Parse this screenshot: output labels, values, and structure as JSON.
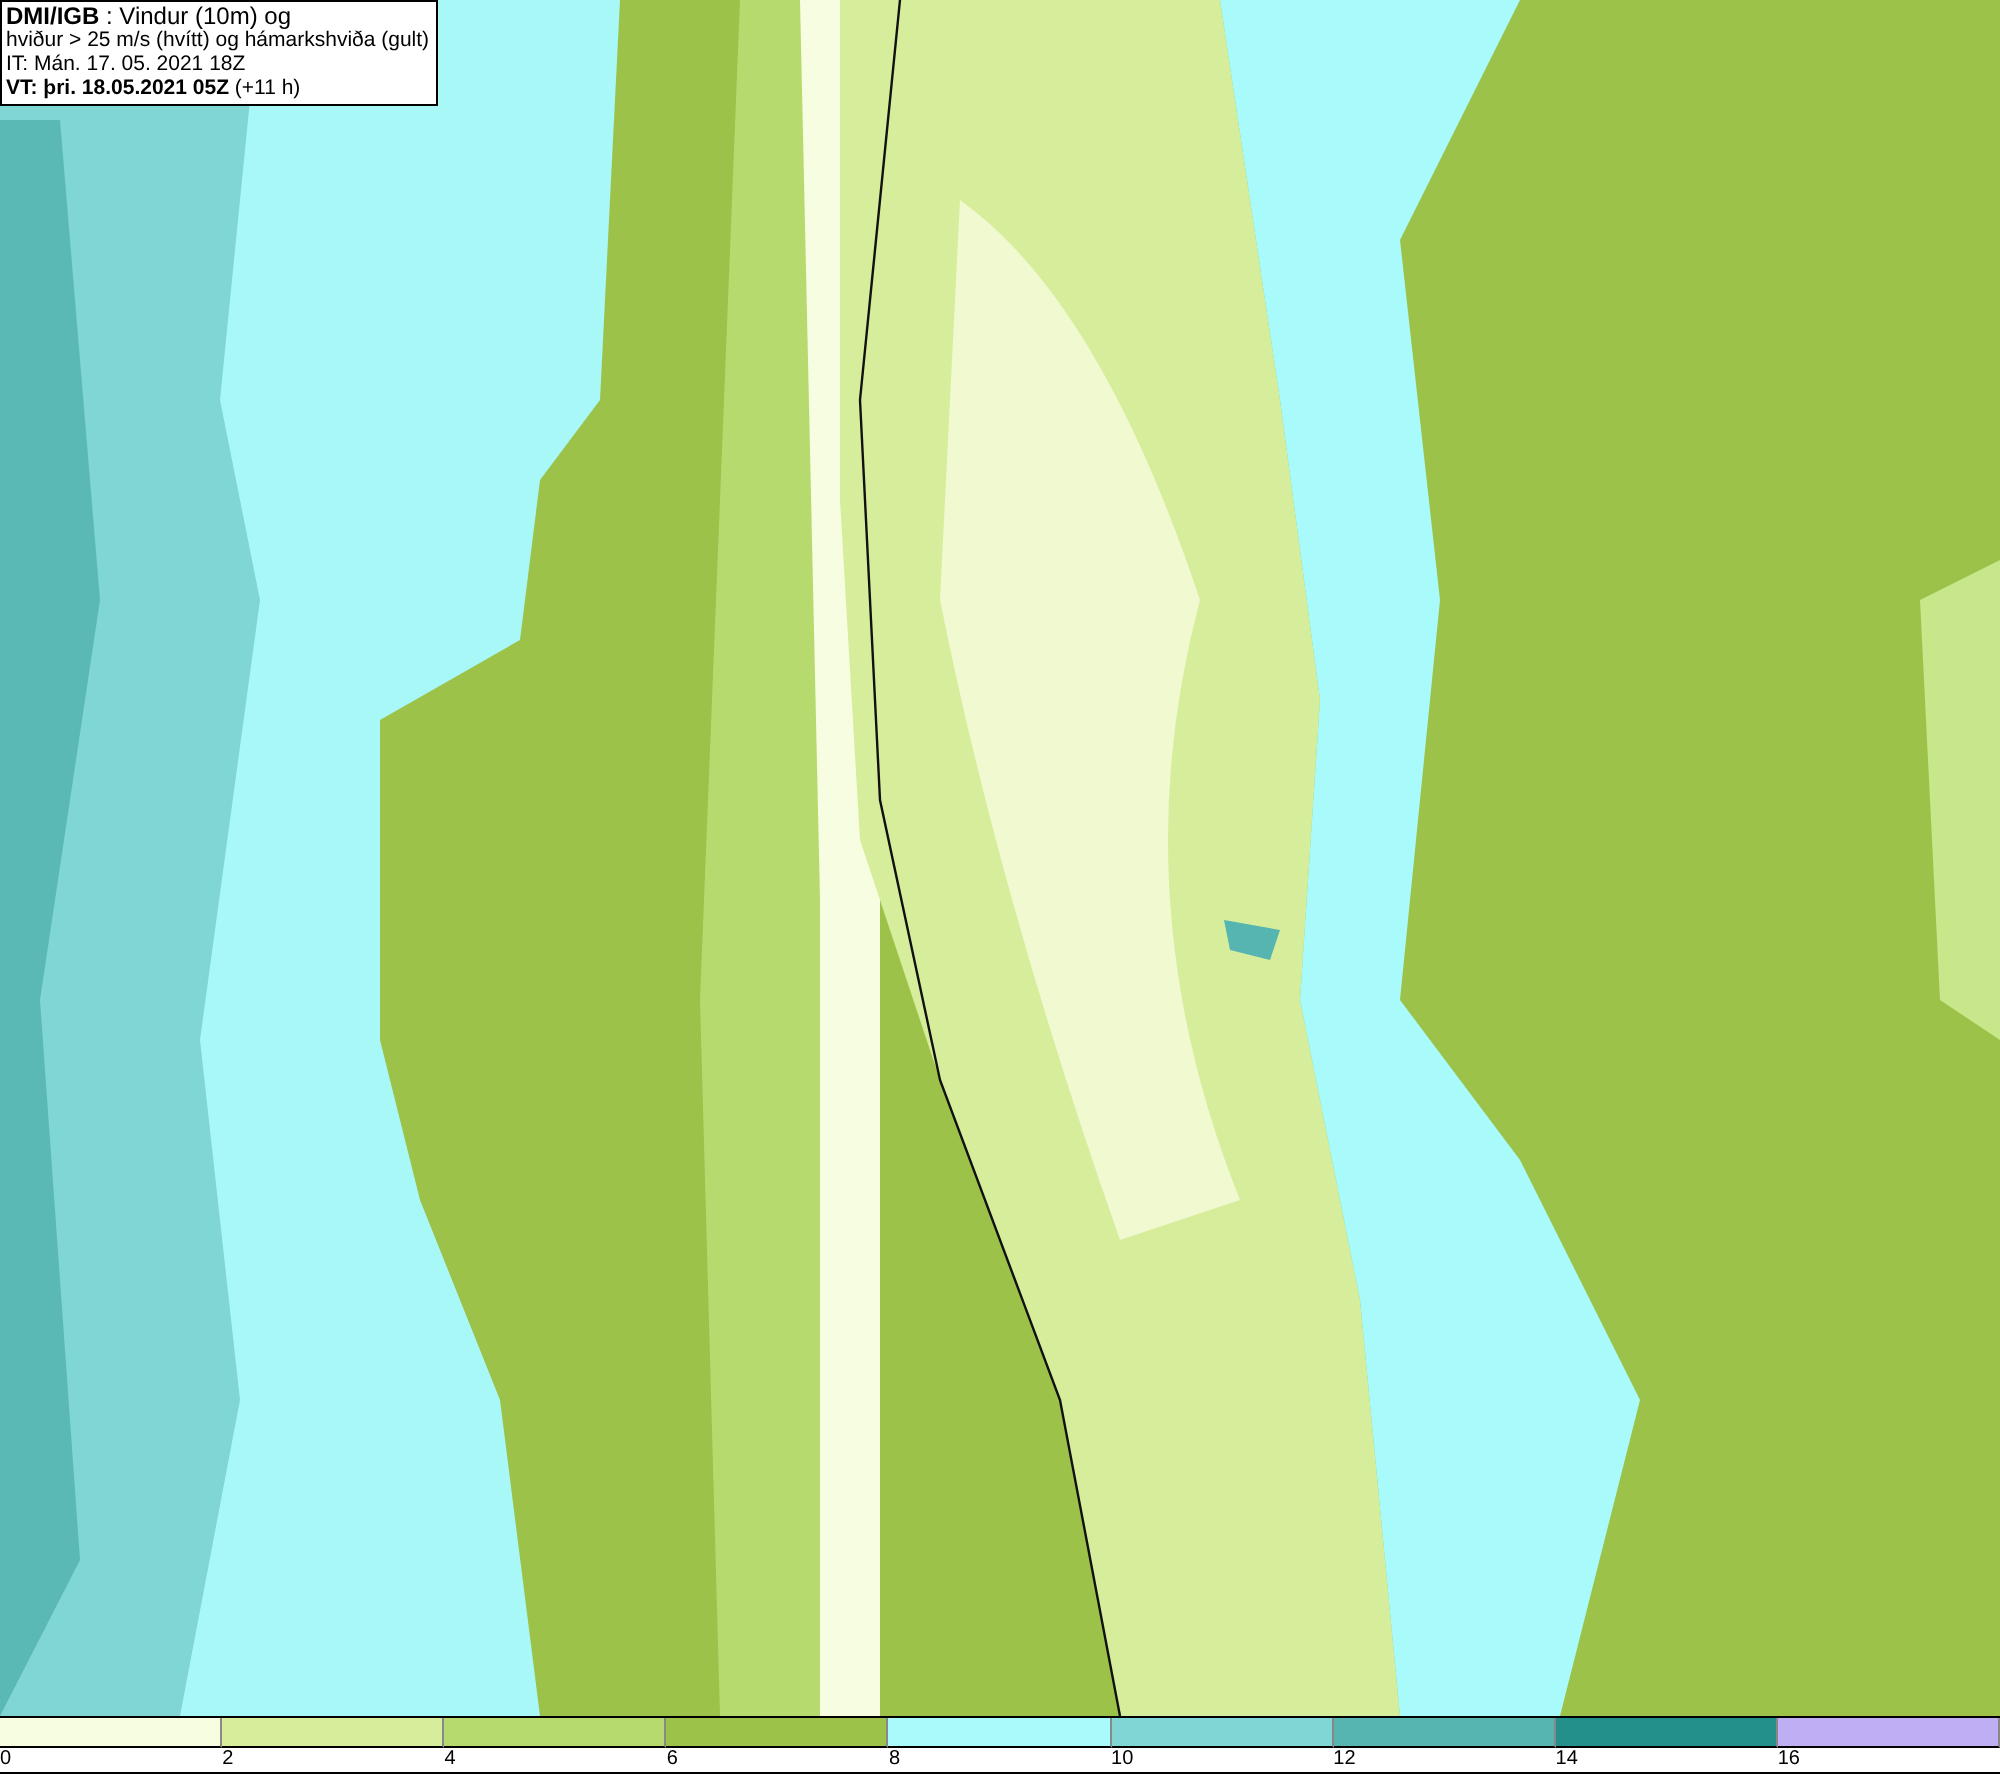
{
  "info_box": {
    "lines": [
      "**DMI/IGB** : Vindur (10m) og",
      "hviður > 25 m/s (hvítt) og hámarkshviða (gult)",
      "IT: Mán. 17. 05. 2021 18Z",
      "**VT: þri. 18.05.2021 05Z** (+11 h)"
    ]
  },
  "legend": [
    {
      "color": "#f7fde0",
      "label": "0"
    },
    {
      "color": "#d6ee9c",
      "label": "2"
    },
    {
      "color": "#b7da6e",
      "label": "4"
    },
    {
      "color": "#9cc24a",
      "label": "6"
    },
    {
      "color": "#a8fbfa",
      "label": "8"
    },
    {
      "color": "#7fd6d4",
      "label": "10"
    },
    {
      "color": "#56b4b1",
      "label": "12"
    },
    {
      "color": "#23908c",
      "label": "14"
    },
    {
      "color": "#c0aef5",
      "label": "16"
    }
  ]
}
